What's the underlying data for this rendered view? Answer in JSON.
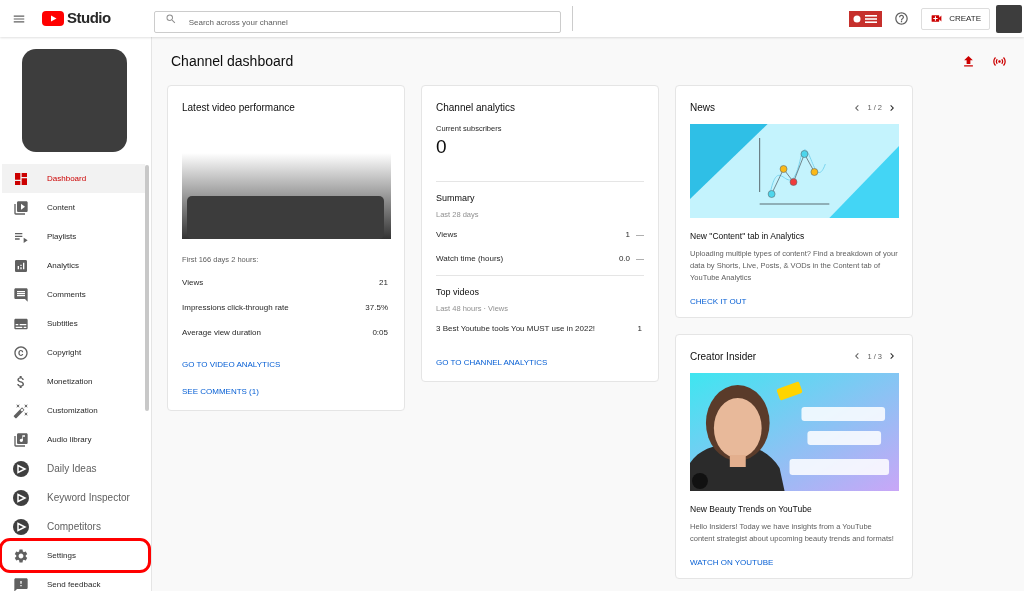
{
  "topbar": {
    "logo_text": "Studio",
    "search": {
      "placeholder": "Search across your channel"
    },
    "create_button": "CREATE"
  },
  "sidebar": {
    "items": [
      {
        "label": "Dashboard",
        "kind": "standard",
        "selected": true,
        "highlighted": false
      },
      {
        "label": "Content",
        "kind": "standard",
        "selected": false,
        "highlighted": false
      },
      {
        "label": "Playlists",
        "kind": "standard",
        "selected": false,
        "highlighted": false
      },
      {
        "label": "Analytics",
        "kind": "standard",
        "selected": false,
        "highlighted": false
      },
      {
        "label": "Comments",
        "kind": "standard",
        "selected": false,
        "highlighted": false
      },
      {
        "label": "Subtitles",
        "kind": "standard",
        "selected": false,
        "highlighted": false
      },
      {
        "label": "Copyright",
        "kind": "standard",
        "selected": false,
        "highlighted": false
      },
      {
        "label": "Monetization",
        "kind": "standard",
        "selected": false,
        "highlighted": false
      },
      {
        "label": "Customization",
        "kind": "standard",
        "selected": false,
        "highlighted": false
      },
      {
        "label": "Audio library",
        "kind": "standard",
        "selected": false,
        "highlighted": false
      },
      {
        "label": "Daily Ideas",
        "kind": "extension",
        "selected": false,
        "highlighted": false
      },
      {
        "label": "Keyword Inspector",
        "kind": "extension",
        "selected": false,
        "highlighted": false
      },
      {
        "label": "Competitors",
        "kind": "extension",
        "selected": false,
        "highlighted": false
      },
      {
        "label": "Settings",
        "kind": "standard",
        "selected": false,
        "highlighted": true
      },
      {
        "label": "Send feedback",
        "kind": "standard",
        "selected": false,
        "highlighted": false
      }
    ]
  },
  "page_title": "Channel dashboard",
  "latest_video": {
    "title": "Latest video performance",
    "period": "First 166 days 2 hours:",
    "stats": [
      {
        "label": "Views",
        "value": "21"
      },
      {
        "label": "Impressions click-through rate",
        "value": "37.5%"
      },
      {
        "label": "Average view duration",
        "value": "0:05"
      }
    ],
    "links": [
      "GO TO VIDEO ANALYTICS",
      "SEE COMMENTS (1)"
    ]
  },
  "channel_analytics": {
    "title": "Channel analytics",
    "subscribers_label": "Current subscribers",
    "subscribers": "0",
    "summary": {
      "title": "Summary",
      "period": "Last 28 days",
      "rows": [
        {
          "label": "Views",
          "value": "1",
          "trend": "—"
        },
        {
          "label": "Watch time (hours)",
          "value": "0.0",
          "trend": "—"
        }
      ]
    },
    "top_videos": {
      "title": "Top videos",
      "period": "Last 48 hours · Views",
      "rows": [
        {
          "label": "3 Best Youtube tools You MUST use in 2022!",
          "value": "1"
        }
      ]
    },
    "link": "GO TO CHANNEL ANALYTICS"
  },
  "news": [
    {
      "heading": "News",
      "pager": "1 / 2",
      "kind": "illustration",
      "title": "New \"Content\" tab in Analytics",
      "body": "Uploading multiple types of content? Find a breakdown of your data by Shorts, Live, Posts, & VODs in the Content tab of YouTube Analytics",
      "link": "CHECK IT OUT"
    },
    {
      "heading": "Creator Insider",
      "pager": "1 / 3",
      "kind": "picture",
      "title": "New Beauty Trends on YouTube",
      "body": "Hello Insiders! Today we have insights from a YouTube content strategist about upcoming beauty trends and formats!",
      "link": "WATCH ON YOUTUBE"
    }
  ]
}
